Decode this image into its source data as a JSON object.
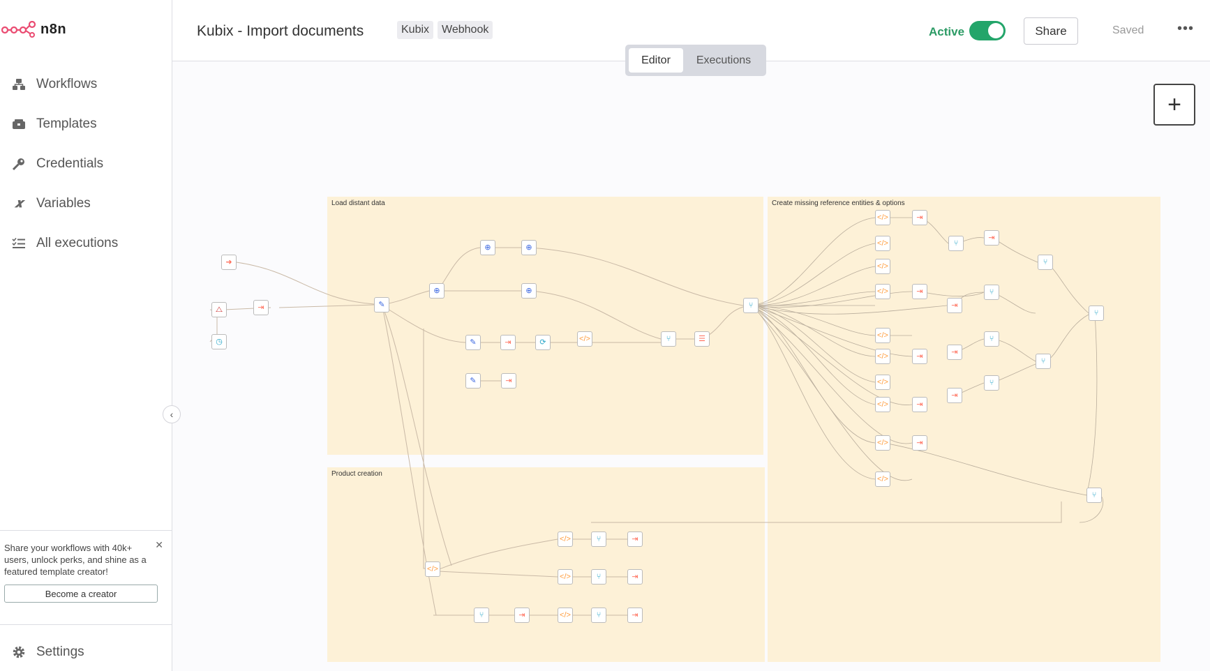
{
  "app": {
    "logo_text": "n8n"
  },
  "sidebar": {
    "items": [
      {
        "label": "Workflows",
        "icon": "workflows-icon"
      },
      {
        "label": "Templates",
        "icon": "templates-icon"
      },
      {
        "label": "Credentials",
        "icon": "key-icon"
      },
      {
        "label": "Variables",
        "icon": "variables-icon"
      },
      {
        "label": "All executions",
        "icon": "list-icon"
      }
    ],
    "promo_text": "Share your workflows with 40k+ users, unlock perks, and shine as a featured template creator!",
    "promo_button": "Become a creator",
    "settings_label": "Settings"
  },
  "header": {
    "workflow_name": "Kubix - Import documents",
    "tags": [
      "Kubix",
      "Webhook"
    ],
    "active_label": "Active",
    "active": true,
    "share_label": "Share",
    "saved_label": "Saved",
    "more_label": "•••"
  },
  "tabs": {
    "editor": "Editor",
    "executions": "Executions",
    "selected": "Editor"
  },
  "canvas": {
    "zoom_in_label": "+",
    "sticky_notes": [
      {
        "label": "Load distant data"
      },
      {
        "label": "Create missing reference entities & options"
      },
      {
        "label": "Product creation"
      }
    ]
  },
  "colors": {
    "accent_active": "#23a56a",
    "sticky_background": "#fdf1d7",
    "node_orange": "#ff6d5a",
    "node_blue": "#3a66e0",
    "node_teal": "#2aa7c9",
    "logo_pink": "#ea4b71"
  }
}
